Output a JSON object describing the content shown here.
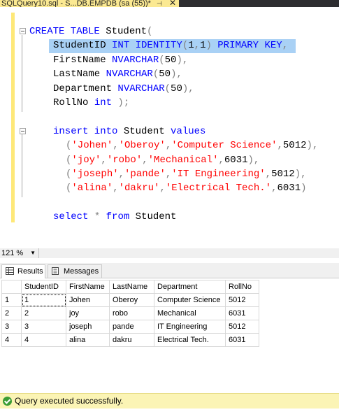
{
  "tab": {
    "title": "SQLQuery10.sql - S...DB.EMPDB (sa (55))*",
    "pin": "⊣",
    "close": "✕"
  },
  "editor": {
    "lines": [
      {
        "parts": [
          {
            "t": "CREATE TABLE",
            "c": "k"
          },
          {
            "t": " Student",
            "c": ""
          },
          {
            "t": "(",
            "c": "g"
          }
        ]
      },
      {
        "parts": [
          {
            "t": "StudentID ",
            "c": ""
          },
          {
            "t": "INT IDENTITY",
            "c": "k"
          },
          {
            "t": "(",
            "c": "g"
          },
          {
            "t": "1",
            "c": ""
          },
          {
            "t": ",",
            "c": "g"
          },
          {
            "t": "1",
            "c": ""
          },
          {
            "t": ")",
            "c": "g"
          },
          {
            "t": " PRIMARY KEY",
            "c": "k"
          },
          {
            "t": ",",
            "c": "g"
          }
        ]
      },
      {
        "parts": [
          {
            "t": "FirstName ",
            "c": ""
          },
          {
            "t": "NVARCHAR",
            "c": "k"
          },
          {
            "t": "(",
            "c": "g"
          },
          {
            "t": "50",
            "c": ""
          },
          {
            "t": "),",
            "c": "g"
          }
        ]
      },
      {
        "parts": [
          {
            "t": "LastName ",
            "c": ""
          },
          {
            "t": "NVARCHAR",
            "c": "k"
          },
          {
            "t": "(",
            "c": "g"
          },
          {
            "t": "50",
            "c": ""
          },
          {
            "t": "),",
            "c": "g"
          }
        ]
      },
      {
        "parts": [
          {
            "t": "Department ",
            "c": ""
          },
          {
            "t": "NVARCHAR",
            "c": "k"
          },
          {
            "t": "(",
            "c": "g"
          },
          {
            "t": "50",
            "c": ""
          },
          {
            "t": "),",
            "c": "g"
          }
        ]
      },
      {
        "parts": [
          {
            "t": "RollNo ",
            "c": ""
          },
          {
            "t": "int",
            "c": "k"
          },
          {
            "t": " );",
            "c": "g"
          }
        ]
      },
      {
        "parts": []
      },
      {
        "parts": [
          {
            "t": "insert into",
            "c": "k"
          },
          {
            "t": " Student ",
            "c": ""
          },
          {
            "t": "values",
            "c": "k"
          }
        ]
      },
      {
        "parts": [
          {
            "t": "(",
            "c": "g"
          },
          {
            "t": "'Johen'",
            "c": "s"
          },
          {
            "t": ",",
            "c": "g"
          },
          {
            "t": "'Oberoy'",
            "c": "s"
          },
          {
            "t": ",",
            "c": "g"
          },
          {
            "t": "'Computer Science'",
            "c": "s"
          },
          {
            "t": ",",
            "c": "g"
          },
          {
            "t": "5012",
            "c": ""
          },
          {
            "t": "),",
            "c": "g"
          }
        ]
      },
      {
        "parts": [
          {
            "t": "(",
            "c": "g"
          },
          {
            "t": "'joy'",
            "c": "s"
          },
          {
            "t": ",",
            "c": "g"
          },
          {
            "t": "'robo'",
            "c": "s"
          },
          {
            "t": ",",
            "c": "g"
          },
          {
            "t": "'Mechanical'",
            "c": "s"
          },
          {
            "t": ",",
            "c": "g"
          },
          {
            "t": "6031",
            "c": ""
          },
          {
            "t": "),",
            "c": "g"
          }
        ]
      },
      {
        "parts": [
          {
            "t": "(",
            "c": "g"
          },
          {
            "t": "'joseph'",
            "c": "s"
          },
          {
            "t": ",",
            "c": "g"
          },
          {
            "t": "'pande'",
            "c": "s"
          },
          {
            "t": ",",
            "c": "g"
          },
          {
            "t": "'IT Engineering'",
            "c": "s"
          },
          {
            "t": ",",
            "c": "g"
          },
          {
            "t": "5012",
            "c": ""
          },
          {
            "t": "),",
            "c": "g"
          }
        ]
      },
      {
        "parts": [
          {
            "t": "(",
            "c": "g"
          },
          {
            "t": "'alina'",
            "c": "s"
          },
          {
            "t": ",",
            "c": "g"
          },
          {
            "t": "'dakru'",
            "c": "s"
          },
          {
            "t": ",",
            "c": "g"
          },
          {
            "t": "'Electrical Tech.'",
            "c": "s"
          },
          {
            "t": ",",
            "c": "g"
          },
          {
            "t": "6031",
            "c": ""
          },
          {
            "t": ")",
            "c": "g"
          }
        ]
      },
      {
        "parts": []
      },
      {
        "parts": [
          {
            "t": "select",
            "c": "k"
          },
          {
            "t": " * ",
            "c": "g"
          },
          {
            "t": "from",
            "c": "k"
          },
          {
            "t": " Student",
            "c": ""
          }
        ]
      }
    ]
  },
  "zoom": {
    "value": "121 %",
    "arrow": "▼"
  },
  "results_tabs": [
    {
      "label": "Results"
    },
    {
      "label": "Messages"
    }
  ],
  "grid": {
    "columns": [
      "",
      "StudentID",
      "FirstName",
      "LastName",
      "Department",
      "RollNo"
    ],
    "rows": [
      [
        "1",
        "1",
        "Johen",
        "Oberoy",
        "Computer Science",
        "5012"
      ],
      [
        "2",
        "2",
        "joy",
        "robo",
        "Mechanical",
        "6031"
      ],
      [
        "3",
        "3",
        "joseph",
        "pande",
        "IT Engineering",
        "5012"
      ],
      [
        "4",
        "4",
        "alina",
        "dakru",
        "Electrical Tech.",
        "6031"
      ]
    ]
  },
  "status": {
    "text": "Query executed successfully."
  },
  "colors": {
    "keyword": "#0000ff",
    "string": "#ff0000",
    "operator": "#808080",
    "selection": "#a9d1f5",
    "status_bg": "#fbf4b5"
  }
}
